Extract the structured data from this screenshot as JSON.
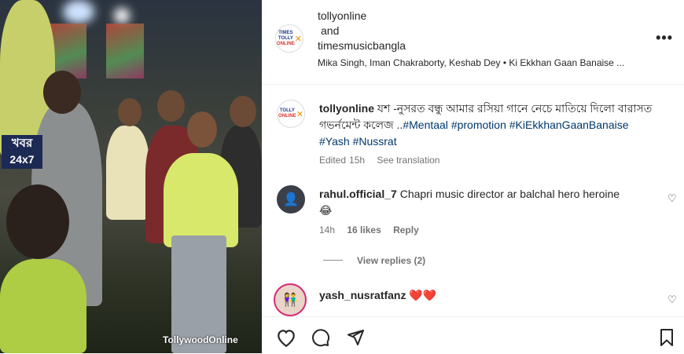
{
  "post": {
    "media": {
      "news_badge_line1": "খবর",
      "news_badge_line2": "24x7",
      "watermark": "TollywoodOnline"
    },
    "header": {
      "author1": "tollyonline",
      "and_text": "and",
      "author2": "timesmusicbangla",
      "audio": "Mika Singh, Iman Chakraborty, Keshab Dey • Ki Ekkhan Gaan Banaise ...",
      "more_icon": "more-horizontal-icon"
    },
    "caption": {
      "username": "tollyonline",
      "text": "যশ -নুসরত বন্ধু আমার রসিয়া গানে নেচে মাতিয়ে দিলো বারাসত গভর্নমেন্ট কলেজ ..",
      "hashtags": [
        "#Mentaal",
        "#promotion",
        "#KiEkkhanGaanBanaise",
        "#Yash",
        "#Nussrat"
      ],
      "edited": "Edited",
      "time": "15h",
      "see_translation": "See translation"
    },
    "comments": [
      {
        "username": "rahul.official_7",
        "text": "Chapri music director ar balchal hero heroine",
        "emoji": "😂",
        "time": "14h",
        "likes": "16 likes",
        "reply": "Reply",
        "view_replies": "View replies (2)"
      },
      {
        "username": "yash_nusratfanz",
        "text": "❤️❤️"
      }
    ],
    "actions": [
      "heart-icon",
      "comment-icon",
      "share-icon",
      "bookmark-icon"
    ]
  }
}
